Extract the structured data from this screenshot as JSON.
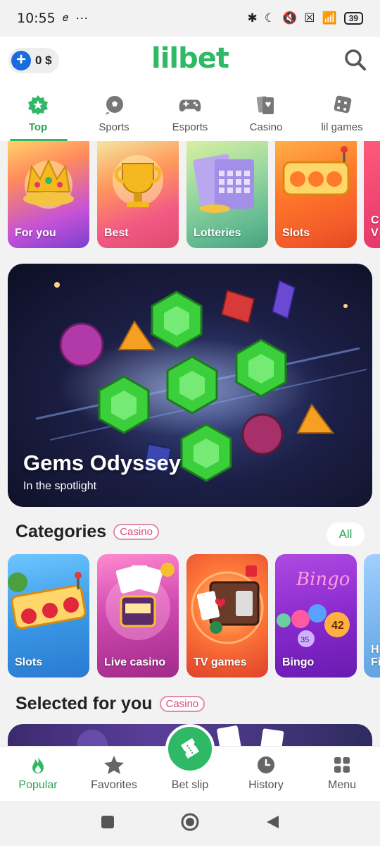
{
  "status_bar": {
    "time": "10:55",
    "extra": "☾ …",
    "battery": "39"
  },
  "header": {
    "balance": "0 $",
    "logo": "lilbet"
  },
  "top_nav": [
    {
      "label": "Top",
      "icon": "star-badge-icon",
      "active": true
    },
    {
      "label": "Sports",
      "icon": "soccer-ball-icon",
      "active": false
    },
    {
      "label": "Esports",
      "icon": "gamepad-icon",
      "active": false
    },
    {
      "label": "Casino",
      "icon": "playing-cards-icon",
      "active": false
    },
    {
      "label": "lil games",
      "icon": "dice-icon",
      "active": false
    }
  ],
  "promos": [
    {
      "label": "For you"
    },
    {
      "label": "Best"
    },
    {
      "label": "Lotteries"
    },
    {
      "label": "Slots"
    },
    {
      "label": "C V"
    }
  ],
  "spotlight": {
    "title": "Gems Odyssey",
    "subtitle": "In the spotlight"
  },
  "categories_section": {
    "title": "Categories",
    "badge": "Casino",
    "all_label": "All"
  },
  "categories": [
    {
      "label": "Slots"
    },
    {
      "label": "Live casino"
    },
    {
      "label": "TV games"
    },
    {
      "label": "Bingo"
    },
    {
      "label": "H Fi"
    }
  ],
  "selected_section": {
    "title": "Selected for you",
    "badge": "Casino"
  },
  "bottom_nav": [
    {
      "label": "Popular",
      "icon": "flame-icon",
      "active": true
    },
    {
      "label": "Favorites",
      "icon": "star-icon",
      "active": false
    },
    {
      "label": "Bet slip",
      "icon": "ticket-icon",
      "active": false
    },
    {
      "label": "History",
      "icon": "clock-icon",
      "active": false
    },
    {
      "label": "Menu",
      "icon": "grid-icon",
      "active": false
    }
  ],
  "colors": {
    "brand_green": "#2fb865",
    "accent_blue": "#1a6ae0",
    "badge_pink": "#d94b75"
  }
}
